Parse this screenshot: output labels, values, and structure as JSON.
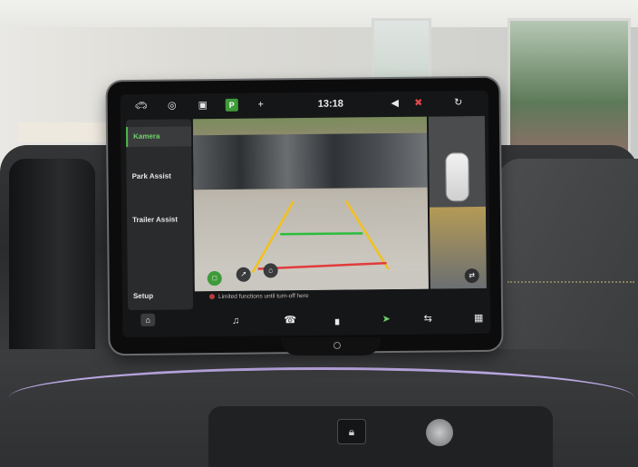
{
  "screen": {
    "clock": "13:18",
    "sidebar": {
      "items": [
        {
          "label": "Kamera",
          "active": true
        },
        {
          "label": "Park Assist",
          "active": false
        },
        {
          "label": "Trailer Assist",
          "active": false
        },
        {
          "label": "Setup",
          "active": false
        }
      ]
    },
    "topbar_icons": [
      "car-icon",
      "driver-assist-icon",
      "car-front-icon",
      "parking-icon",
      "plus-icon",
      "volume-icon",
      "mute-icon",
      "status-icon"
    ],
    "park_symbol": "P",
    "dock_icons": [
      "home-icon",
      "music-icon",
      "phone-icon",
      "apps-icon",
      "navigation-icon",
      "connect-icon",
      "grid-icon"
    ],
    "warning_text": "Limited functions until turn-off here",
    "guide_colors": {
      "near": "#e23b3b",
      "mid": "#2bbd3b",
      "far": "#f3c11b"
    }
  },
  "console": {
    "slot_icon": "lock-icon"
  }
}
